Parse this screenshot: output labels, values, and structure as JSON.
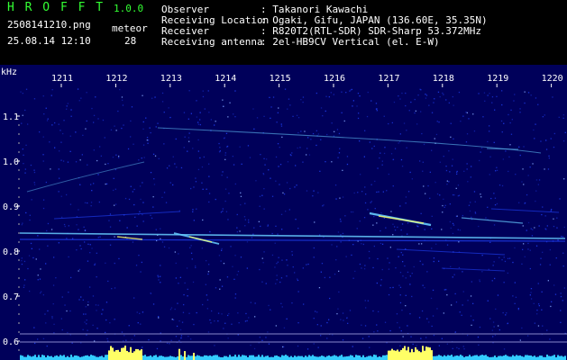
{
  "header": {
    "app_name": "H R O F F T",
    "version": "1.0.0",
    "filename": "2508141210.png",
    "datetime": "25.08.14 12:10",
    "count_label": "meteor",
    "count_value": "28",
    "info_rows": [
      {
        "label": "Observer",
        "value": ": Takanori Kawachi"
      },
      {
        "label": "Receiving Location",
        "value": ": Ogaki, Gifu, JAPAN (136.60E, 35.35N)"
      },
      {
        "label": "Receiver",
        "value": ": R820T2(RTL-SDR) SDR-Sharp 53.372MHz"
      },
      {
        "label": "Receiving antenna",
        "value": ": 2el-HB9CV Vertical (el. E-W)"
      }
    ]
  },
  "spectrogram": {
    "y_unit": "kHz",
    "y_ticks": [
      "1.1",
      "1.0",
      "0.9",
      "0.8",
      "0.7",
      "0.6"
    ],
    "x_ticks": [
      "1211",
      "1212",
      "1213",
      "1214",
      "1215",
      "1216",
      "1217",
      "1218",
      "1219",
      "1220"
    ],
    "colors": {
      "background": "#00005a",
      "noise": "#2244ff",
      "trace": "#66ccff",
      "hot": "#ffff66",
      "level_bar": "#33ccff"
    }
  }
}
